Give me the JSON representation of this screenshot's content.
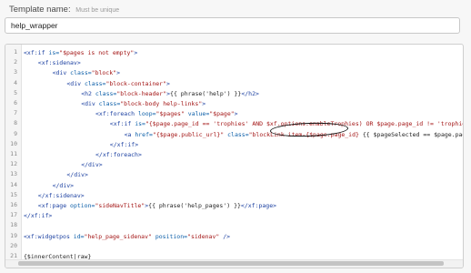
{
  "form": {
    "label": "Template name:",
    "hint": "Must be unique",
    "value": "help_wrapper"
  },
  "editor": {
    "lines": [
      {
        "num": "1",
        "tokens": [
          {
            "t": "tg",
            "v": "<xf:if "
          },
          {
            "t": "at",
            "v": "is="
          },
          {
            "t": "st",
            "v": "\"$pages is not empty\""
          },
          {
            "t": "tg",
            "v": ">"
          }
        ]
      },
      {
        "num": "2",
        "indent": 4,
        "tokens": [
          {
            "t": "tg",
            "v": "<xf:sidenav>"
          }
        ]
      },
      {
        "num": "3",
        "indent": 8,
        "tokens": [
          {
            "t": "tg",
            "v": "<div "
          },
          {
            "t": "at",
            "v": "class="
          },
          {
            "t": "st",
            "v": "\"block\""
          },
          {
            "t": "tg",
            "v": ">"
          }
        ]
      },
      {
        "num": "4",
        "indent": 12,
        "tokens": [
          {
            "t": "tg",
            "v": "<div "
          },
          {
            "t": "at",
            "v": "class="
          },
          {
            "t": "st",
            "v": "\"block-container\""
          },
          {
            "t": "tg",
            "v": ">"
          }
        ]
      },
      {
        "num": "5",
        "indent": 16,
        "tokens": [
          {
            "t": "tg",
            "v": "<h2 "
          },
          {
            "t": "at",
            "v": "class="
          },
          {
            "t": "st",
            "v": "\"block-header\""
          },
          {
            "t": "tg",
            "v": ">"
          },
          {
            "t": "tx",
            "v": "{{ phrase('help') }}"
          },
          {
            "t": "tg",
            "v": "</h2>"
          }
        ]
      },
      {
        "num": "6",
        "indent": 16,
        "tokens": [
          {
            "t": "tg",
            "v": "<div "
          },
          {
            "t": "at",
            "v": "class="
          },
          {
            "t": "st",
            "v": "\"block-body help-links\""
          },
          {
            "t": "tg",
            "v": ">"
          }
        ]
      },
      {
        "num": "7",
        "indent": 20,
        "tokens": [
          {
            "t": "tg",
            "v": "<xf:foreach "
          },
          {
            "t": "at",
            "v": "loop="
          },
          {
            "t": "st",
            "v": "\"$pages\""
          },
          {
            "t": "tx",
            "v": " "
          },
          {
            "t": "at",
            "v": "value="
          },
          {
            "t": "st",
            "v": "\"$page\""
          },
          {
            "t": "tg",
            "v": ">"
          }
        ]
      },
      {
        "num": "8",
        "indent": 24,
        "tokens": [
          {
            "t": "tg",
            "v": "<xf:if "
          },
          {
            "t": "at",
            "v": "is="
          },
          {
            "t": "st",
            "v": "\"{$page.page_id == 'trophies' AND $xf.options.enableTrophies) OR $page.page_id != 'trophies"
          }
        ]
      },
      {
        "num": "9",
        "indent": 28,
        "tokens": [
          {
            "t": "tg",
            "v": "<a "
          },
          {
            "t": "at",
            "v": "href="
          },
          {
            "t": "st",
            "v": "\"{$page.public_url}\""
          },
          {
            "t": "tx",
            "v": " "
          },
          {
            "t": "at",
            "v": "class="
          },
          {
            "t": "st",
            "v": "\"blockLink item-{$page.page_id}"
          },
          {
            "t": "tx",
            "v": " {{ $pageSelected == $page.page_id"
          }
        ]
      },
      {
        "num": "10",
        "indent": 24,
        "tokens": [
          {
            "t": "tg",
            "v": "</xf:if>"
          }
        ]
      },
      {
        "num": "11",
        "indent": 20,
        "tokens": [
          {
            "t": "tg",
            "v": "</xf:foreach>"
          }
        ]
      },
      {
        "num": "12",
        "indent": 16,
        "tokens": [
          {
            "t": "tg",
            "v": "</div>"
          }
        ]
      },
      {
        "num": "13",
        "indent": 12,
        "tokens": [
          {
            "t": "tg",
            "v": "</div>"
          }
        ]
      },
      {
        "num": "14",
        "indent": 8,
        "tokens": [
          {
            "t": "tg",
            "v": "</div>"
          }
        ]
      },
      {
        "num": "15",
        "indent": 4,
        "tokens": [
          {
            "t": "tg",
            "v": "</xf:sidenav>"
          }
        ]
      },
      {
        "num": "16",
        "indent": 4,
        "tokens": [
          {
            "t": "tg",
            "v": "<xf:page "
          },
          {
            "t": "at",
            "v": "option="
          },
          {
            "t": "st",
            "v": "\"sideNavTitle\""
          },
          {
            "t": "tg",
            "v": ">"
          },
          {
            "t": "tx",
            "v": "{{ phrase('help_pages') }}"
          },
          {
            "t": "tg",
            "v": "</xf:page>"
          }
        ]
      },
      {
        "num": "17",
        "tokens": [
          {
            "t": "tg",
            "v": "</xf:if>"
          }
        ]
      },
      {
        "num": "18",
        "tokens": []
      },
      {
        "num": "19",
        "tokens": [
          {
            "t": "tg",
            "v": "<xf:widgetpos "
          },
          {
            "t": "at",
            "v": "id="
          },
          {
            "t": "st",
            "v": "\"help_page_sidenav\""
          },
          {
            "t": "tx",
            "v": " "
          },
          {
            "t": "at",
            "v": "position="
          },
          {
            "t": "st",
            "v": "\"sidenav\""
          },
          {
            "t": "tg",
            "v": " />"
          }
        ]
      },
      {
        "num": "20",
        "tokens": []
      },
      {
        "num": "21",
        "tokens": [
          {
            "t": "tx",
            "v": "{$innerContent|raw}"
          }
        ]
      }
    ]
  }
}
